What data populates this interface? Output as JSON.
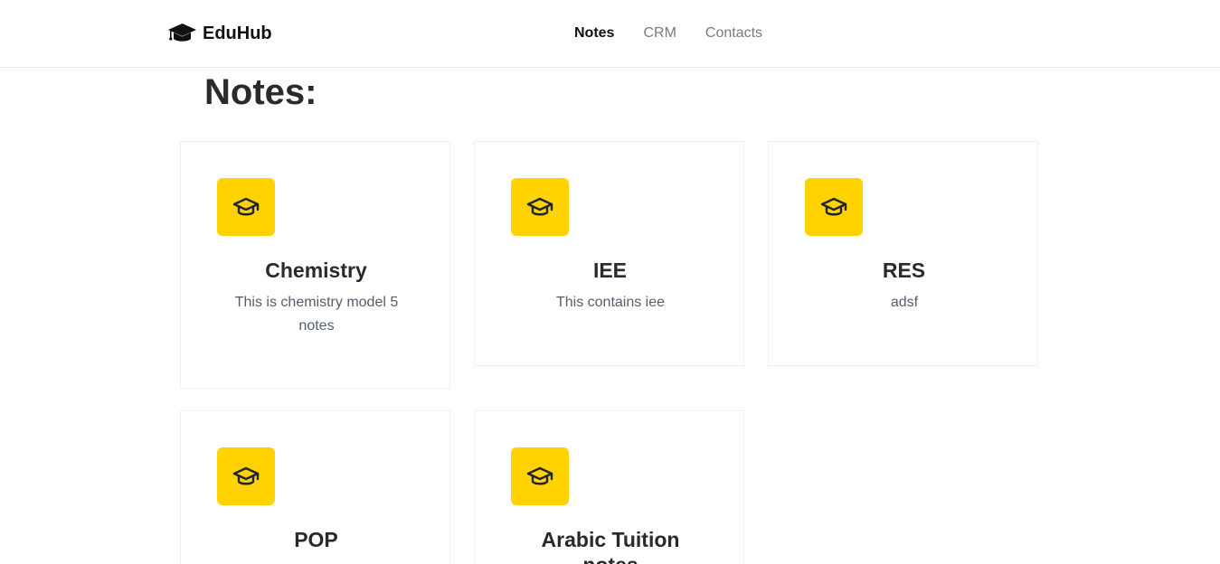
{
  "navbar": {
    "brand": "EduHub",
    "links": [
      {
        "label": "Notes",
        "active": true
      },
      {
        "label": "CRM",
        "active": false
      },
      {
        "label": "Contacts",
        "active": false
      }
    ]
  },
  "page": {
    "title": "Notes:"
  },
  "cards": [
    {
      "title": "Chemistry",
      "description": "This is chemistry model 5 notes",
      "icon": "graduation-cap-icon"
    },
    {
      "title": "IEE",
      "description": "This contains iee",
      "icon": "graduation-cap-icon"
    },
    {
      "title": "RES",
      "description": "adsf",
      "icon": "graduation-cap-icon"
    },
    {
      "title": "POP",
      "description": "",
      "icon": "graduation-cap-icon"
    },
    {
      "title": "Arabic Tuition notes",
      "description": "",
      "icon": "graduation-cap-icon"
    }
  ],
  "colors": {
    "accent": "#ffd200",
    "text": "#2a2a2a",
    "muted": "#7a7a7a"
  }
}
